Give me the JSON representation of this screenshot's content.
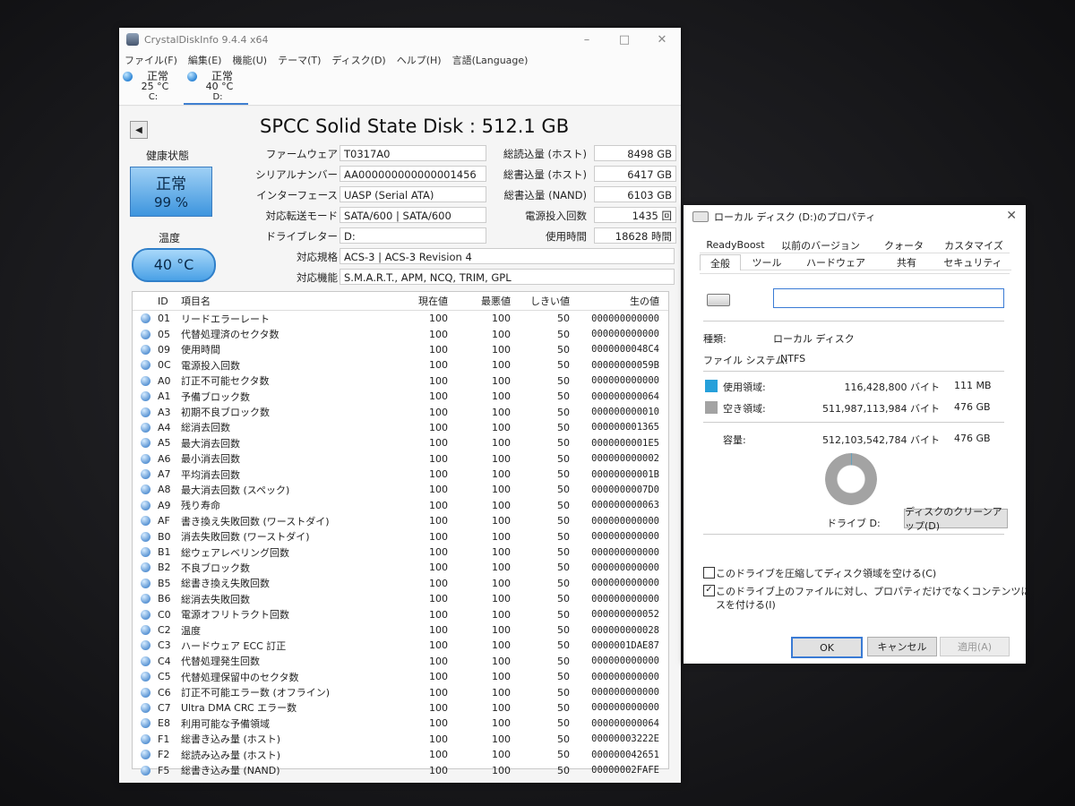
{
  "cdi": {
    "title": "CrystalDiskInfo 9.4.4 x64",
    "menu": [
      "ファイル(F)",
      "編集(E)",
      "機能(U)",
      "テーマ(T)",
      "ディスク(D)",
      "ヘルプ(H)",
      "言語(Language)"
    ],
    "drives": [
      {
        "status": "正常",
        "temp": "25 °C",
        "letter": "C:"
      },
      {
        "status": "正常",
        "temp": "40 °C",
        "letter": "D:"
      }
    ],
    "disk_title": "SPCC Solid State Disk : 512.1 GB",
    "health_label": "健康状態",
    "health_status": "正常",
    "health_percent": "99 %",
    "temp_label": "温度",
    "temp_value": "40 °C",
    "info": {
      "firmware_k": "ファームウェア",
      "firmware_v": "T0317A0",
      "serial_k": "シリアルナンバー",
      "serial_v": "AA000000000000001456",
      "interface_k": "インターフェース",
      "interface_v": "UASP (Serial ATA)",
      "transfer_k": "対応転送モード",
      "transfer_v": "SATA/600 | SATA/600",
      "letter_k": "ドライブレター",
      "letter_v": "D:",
      "standard_k": "対応規格",
      "standard_v": "ACS-3 | ACS-3 Revision 4",
      "features_k": "対応機能",
      "features_v": "S.M.A.R.T., APM, NCQ, TRIM, GPL"
    },
    "stats": {
      "host_reads_k": "総読込量 (ホスト)",
      "host_reads_v": "8498 GB",
      "host_writes_k": "総書込量 (ホスト)",
      "host_writes_v": "6417 GB",
      "nand_writes_k": "総書込量 (NAND)",
      "nand_writes_v": "6103 GB",
      "power_count_k": "電源投入回数",
      "power_count_v": "1435 回",
      "power_hours_k": "使用時間",
      "power_hours_v": "18628 時間"
    },
    "headers": {
      "id": "ID",
      "name": "項目名",
      "current": "現在値",
      "worst": "最悪値",
      "threshold": "しきい値",
      "raw": "生の値"
    },
    "attributes": [
      {
        "id": "01",
        "name": "リードエラーレート",
        "cur": "100",
        "worst": "100",
        "thr": "50",
        "raw": "000000000000"
      },
      {
        "id": "05",
        "name": "代替処理済のセクタ数",
        "cur": "100",
        "worst": "100",
        "thr": "50",
        "raw": "000000000000"
      },
      {
        "id": "09",
        "name": "使用時間",
        "cur": "100",
        "worst": "100",
        "thr": "50",
        "raw": "0000000048C4"
      },
      {
        "id": "0C",
        "name": "電源投入回数",
        "cur": "100",
        "worst": "100",
        "thr": "50",
        "raw": "00000000059B"
      },
      {
        "id": "A0",
        "name": "訂正不可能セクタ数",
        "cur": "100",
        "worst": "100",
        "thr": "50",
        "raw": "000000000000"
      },
      {
        "id": "A1",
        "name": "予備ブロック数",
        "cur": "100",
        "worst": "100",
        "thr": "50",
        "raw": "000000000064"
      },
      {
        "id": "A3",
        "name": "初期不良ブロック数",
        "cur": "100",
        "worst": "100",
        "thr": "50",
        "raw": "000000000010"
      },
      {
        "id": "A4",
        "name": "総消去回数",
        "cur": "100",
        "worst": "100",
        "thr": "50",
        "raw": "000000001365"
      },
      {
        "id": "A5",
        "name": "最大消去回数",
        "cur": "100",
        "worst": "100",
        "thr": "50",
        "raw": "0000000001E5"
      },
      {
        "id": "A6",
        "name": "最小消去回数",
        "cur": "100",
        "worst": "100",
        "thr": "50",
        "raw": "000000000002"
      },
      {
        "id": "A7",
        "name": "平均消去回数",
        "cur": "100",
        "worst": "100",
        "thr": "50",
        "raw": "00000000001B"
      },
      {
        "id": "A8",
        "name": "最大消去回数 (スペック)",
        "cur": "100",
        "worst": "100",
        "thr": "50",
        "raw": "0000000007D0"
      },
      {
        "id": "A9",
        "name": "残り寿命",
        "cur": "100",
        "worst": "100",
        "thr": "50",
        "raw": "000000000063"
      },
      {
        "id": "AF",
        "name": "書き換え失敗回数 (ワーストダイ)",
        "cur": "100",
        "worst": "100",
        "thr": "50",
        "raw": "000000000000"
      },
      {
        "id": "B0",
        "name": "消去失敗回数 (ワーストダイ)",
        "cur": "100",
        "worst": "100",
        "thr": "50",
        "raw": "000000000000"
      },
      {
        "id": "B1",
        "name": "総ウェアレベリング回数",
        "cur": "100",
        "worst": "100",
        "thr": "50",
        "raw": "000000000000"
      },
      {
        "id": "B2",
        "name": "不良ブロック数",
        "cur": "100",
        "worst": "100",
        "thr": "50",
        "raw": "000000000000"
      },
      {
        "id": "B5",
        "name": "総書き換え失敗回数",
        "cur": "100",
        "worst": "100",
        "thr": "50",
        "raw": "000000000000"
      },
      {
        "id": "B6",
        "name": "総消去失敗回数",
        "cur": "100",
        "worst": "100",
        "thr": "50",
        "raw": "000000000000"
      },
      {
        "id": "C0",
        "name": "電源オフリトラクト回数",
        "cur": "100",
        "worst": "100",
        "thr": "50",
        "raw": "000000000052"
      },
      {
        "id": "C2",
        "name": "温度",
        "cur": "100",
        "worst": "100",
        "thr": "50",
        "raw": "000000000028"
      },
      {
        "id": "C3",
        "name": "ハードウェア ECC 訂正",
        "cur": "100",
        "worst": "100",
        "thr": "50",
        "raw": "0000001DAE87"
      },
      {
        "id": "C4",
        "name": "代替処理発生回数",
        "cur": "100",
        "worst": "100",
        "thr": "50",
        "raw": "000000000000"
      },
      {
        "id": "C5",
        "name": "代替処理保留中のセクタ数",
        "cur": "100",
        "worst": "100",
        "thr": "50",
        "raw": "000000000000"
      },
      {
        "id": "C6",
        "name": "訂正不可能エラー数 (オフライン)",
        "cur": "100",
        "worst": "100",
        "thr": "50",
        "raw": "000000000000"
      },
      {
        "id": "C7",
        "name": "Ultra DMA CRC エラー数",
        "cur": "100",
        "worst": "100",
        "thr": "50",
        "raw": "000000000000"
      },
      {
        "id": "E8",
        "name": "利用可能な予備領域",
        "cur": "100",
        "worst": "100",
        "thr": "50",
        "raw": "000000000064"
      },
      {
        "id": "F1",
        "name": "総書き込み量 (ホスト)",
        "cur": "100",
        "worst": "100",
        "thr": "50",
        "raw": "00000003222E"
      },
      {
        "id": "F2",
        "name": "総読み込み量 (ホスト)",
        "cur": "100",
        "worst": "100",
        "thr": "50",
        "raw": "000000042651"
      },
      {
        "id": "F5",
        "name": "総書き込み量 (NAND)",
        "cur": "100",
        "worst": "100",
        "thr": "50",
        "raw": "00000002FAFE"
      }
    ]
  },
  "props": {
    "title": "ローカル ディスク (D:)のプロパティ",
    "tabs_top": [
      "ReadyBoost",
      "以前のバージョン",
      "クォータ",
      "カスタマイズ"
    ],
    "tabs_bottom": [
      "全般",
      "ツール",
      "ハードウェア",
      "共有",
      "セキュリティ"
    ],
    "label_value": "",
    "type_k": "種類:",
    "type_v": "ローカル ディスク",
    "fs_k": "ファイル システム:",
    "fs_v": "NTFS",
    "used_k": "使用領域:",
    "used_bytes": "116,428,800 バイト",
    "used_size": "111 MB",
    "free_k": "空き領域:",
    "free_bytes": "511,987,113,984 バイト",
    "free_size": "476 GB",
    "cap_k": "容量:",
    "cap_bytes": "512,103,542,784 バイト",
    "cap_size": "476 GB",
    "used_fraction": 0.0002,
    "used_color": "#26a0da",
    "free_color": "#a3a3a3",
    "drive_label": "ドライブ D:",
    "cleanup_button": "ディスクのクリーンアップ(D)",
    "compress_label": "このドライブを圧縮してディスク領域を空ける(C)",
    "compress_checked": false,
    "index_label_1": "このドライブ上のファイルに対し、プロパティだけでなくコンテンツにもインデック",
    "index_label_2": "スを付ける(I)",
    "index_checked": true,
    "ok": "OK",
    "cancel": "キャンセル",
    "apply": "適用(A)"
  }
}
